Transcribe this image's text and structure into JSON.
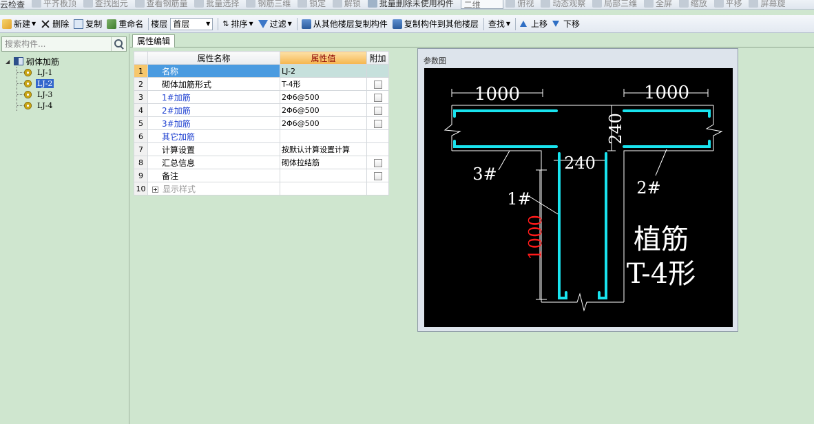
{
  "toolbar_top": {
    "items": [
      "云检查",
      "平齐板顶",
      "查找图元",
      "查看钢筋量",
      "批量选择",
      "钢筋三维",
      "锁定",
      "解锁",
      "批量删除未使用构件"
    ],
    "view_combo": "二维",
    "items_right": [
      "俯视",
      "动态观察",
      "局部三维",
      "全屏",
      "缩放",
      "平移",
      "屏幕旋"
    ]
  },
  "toolbar": {
    "new": "新建",
    "delete": "删除",
    "copy": "复制",
    "rename": "重命名",
    "floor_label": "楼层",
    "floor_value": "首层",
    "sort": "排序",
    "filter": "过滤",
    "copy_from_floor": "从其他楼层复制构件",
    "copy_to_floor": "复制构件到其他楼层",
    "find": "查找",
    "move_up": "上移",
    "move_down": "下移"
  },
  "search": {
    "placeholder": "搜索构件..."
  },
  "tree": {
    "root": "砌体加筋",
    "items": [
      {
        "label": "LJ-1",
        "selected": false
      },
      {
        "label": "LJ-2",
        "selected": true
      },
      {
        "label": "LJ-3",
        "selected": false
      },
      {
        "label": "LJ-4",
        "selected": false
      }
    ]
  },
  "tab": {
    "label": "属性编辑"
  },
  "grid": {
    "headers": {
      "name": "属性名称",
      "value": "属性值",
      "extra": "附加"
    },
    "rows": [
      {
        "no": "1",
        "name": "名称",
        "value": "LJ-2",
        "style": "normal",
        "checkbox": false,
        "selected": true
      },
      {
        "no": "2",
        "name": "砌体加筋形式",
        "value": "T-4形",
        "style": "normal",
        "checkbox": true,
        "selected": false
      },
      {
        "no": "3",
        "name": "1#加筋",
        "value": "2Φ6@500",
        "style": "blue",
        "checkbox": true,
        "selected": false
      },
      {
        "no": "4",
        "name": "2#加筋",
        "value": "2Φ6@500",
        "style": "blue",
        "checkbox": true,
        "selected": false
      },
      {
        "no": "5",
        "name": "3#加筋",
        "value": "2Φ6@500",
        "style": "blue",
        "checkbox": true,
        "selected": false
      },
      {
        "no": "6",
        "name": "其它加筋",
        "value": "",
        "style": "blue",
        "checkbox": false,
        "selected": false
      },
      {
        "no": "7",
        "name": "计算设置",
        "value": "按默认计算设置计算",
        "style": "normal",
        "checkbox": false,
        "selected": false
      },
      {
        "no": "8",
        "name": "汇总信息",
        "value": "砌体拉结筋",
        "style": "normal",
        "checkbox": true,
        "selected": false
      },
      {
        "no": "9",
        "name": "备注",
        "value": "",
        "style": "normal",
        "checkbox": true,
        "selected": false
      },
      {
        "no": "10",
        "name": "显示样式",
        "value": "",
        "style": "grey",
        "checkbox": false,
        "selected": false,
        "expandable": true
      }
    ]
  },
  "param_panel": {
    "title": "参数图",
    "dims": {
      "left_len": "1000",
      "right_len": "1000",
      "wall_thk_vertical": "240",
      "wall_thk_horizontal": "240",
      "stem_len": "1000"
    },
    "bar_labels": {
      "bar1": "1#",
      "bar2": "2#",
      "bar3": "3#"
    },
    "caption_line1": "植筋",
    "caption_line2": "T-4形",
    "colors": {
      "rebar": "#19e3ee",
      "dim": "#ffffff",
      "stem_dim": "#ff1a1a",
      "background": "#000000"
    }
  }
}
